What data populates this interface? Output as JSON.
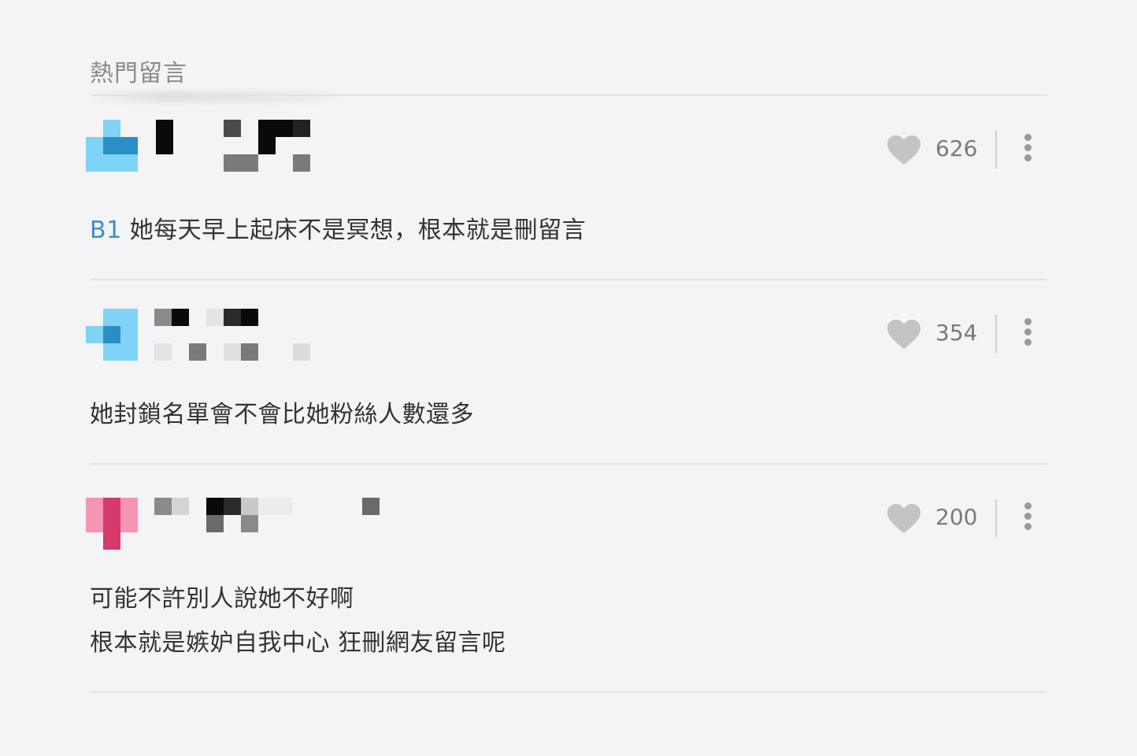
{
  "section": {
    "title": "熱門留言"
  },
  "comments": [
    {
      "floor": "B1",
      "text": "她每天早上起床不是冥想，根本就是刪留言",
      "likes": "626",
      "like_icon": "heart-icon",
      "more_icon": "more-vertical-icon",
      "avatar_color": "#7fd3f7"
    },
    {
      "text": "她封鎖名單會不會比她粉絲人數還多",
      "likes": "354",
      "like_icon": "heart-icon",
      "more_icon": "more-vertical-icon",
      "avatar_color": "#7fd3f7"
    },
    {
      "text_lines": [
        "可能不許別人說她不好啊",
        "根本就是嫉妒自我中心 狂刪網友留言呢"
      ],
      "likes": "200",
      "like_icon": "heart-icon",
      "more_icon": "more-vertical-icon",
      "avatar_color": "#f594b3"
    }
  ]
}
